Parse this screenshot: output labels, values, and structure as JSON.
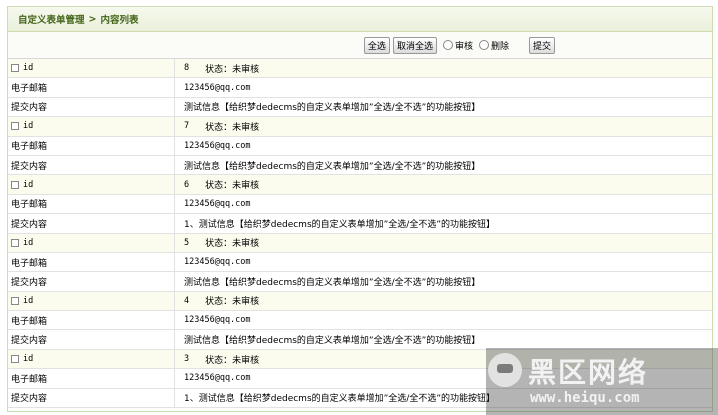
{
  "breadcrumb": {
    "parent": "自定义表单管理",
    "separator": ">",
    "current": "内容列表"
  },
  "toolbar": {
    "select_all": "全选",
    "cancel_select": "取消全选",
    "radio_review": "审核",
    "radio_delete": "删除",
    "submit": "提交"
  },
  "labels": {
    "id": "id",
    "status": "状态：",
    "email": "电子邮箱",
    "content": "提交内容"
  },
  "entries": [
    {
      "id": "8",
      "status": "未审核",
      "email": "123456@qq.com",
      "content": "测试信息【给织梦dedecms的自定义表单增加”全选/全不选”的功能按钮】"
    },
    {
      "id": "7",
      "status": "未审核",
      "email": "123456@qq.com",
      "content": "测试信息【给织梦dedecms的自定义表单增加”全选/全不选”的功能按钮】"
    },
    {
      "id": "6",
      "status": "未审核",
      "email": "123456@qq.com",
      "content": "1、测试信息【给织梦dedecms的自定义表单增加”全选/全不选”的功能按钮】"
    },
    {
      "id": "5",
      "status": "未审核",
      "email": "123456@qq.com",
      "content": "测试信息【给织梦dedecms的自定义表单增加”全选/全不选”的功能按钮】"
    },
    {
      "id": "4",
      "status": "未审核",
      "email": "123456@qq.com",
      "content": "测试信息【给织梦dedecms的自定义表单增加”全选/全不选”的功能按钮】"
    },
    {
      "id": "3",
      "status": "未审核",
      "email": "123456@qq.com",
      "content": "1、测试信息【给织梦dedecms的自定义表单增加”全选/全不选”的功能按钮】"
    }
  ],
  "watermark": {
    "text": "黑区网络",
    "url": "www.heiqu.com"
  }
}
